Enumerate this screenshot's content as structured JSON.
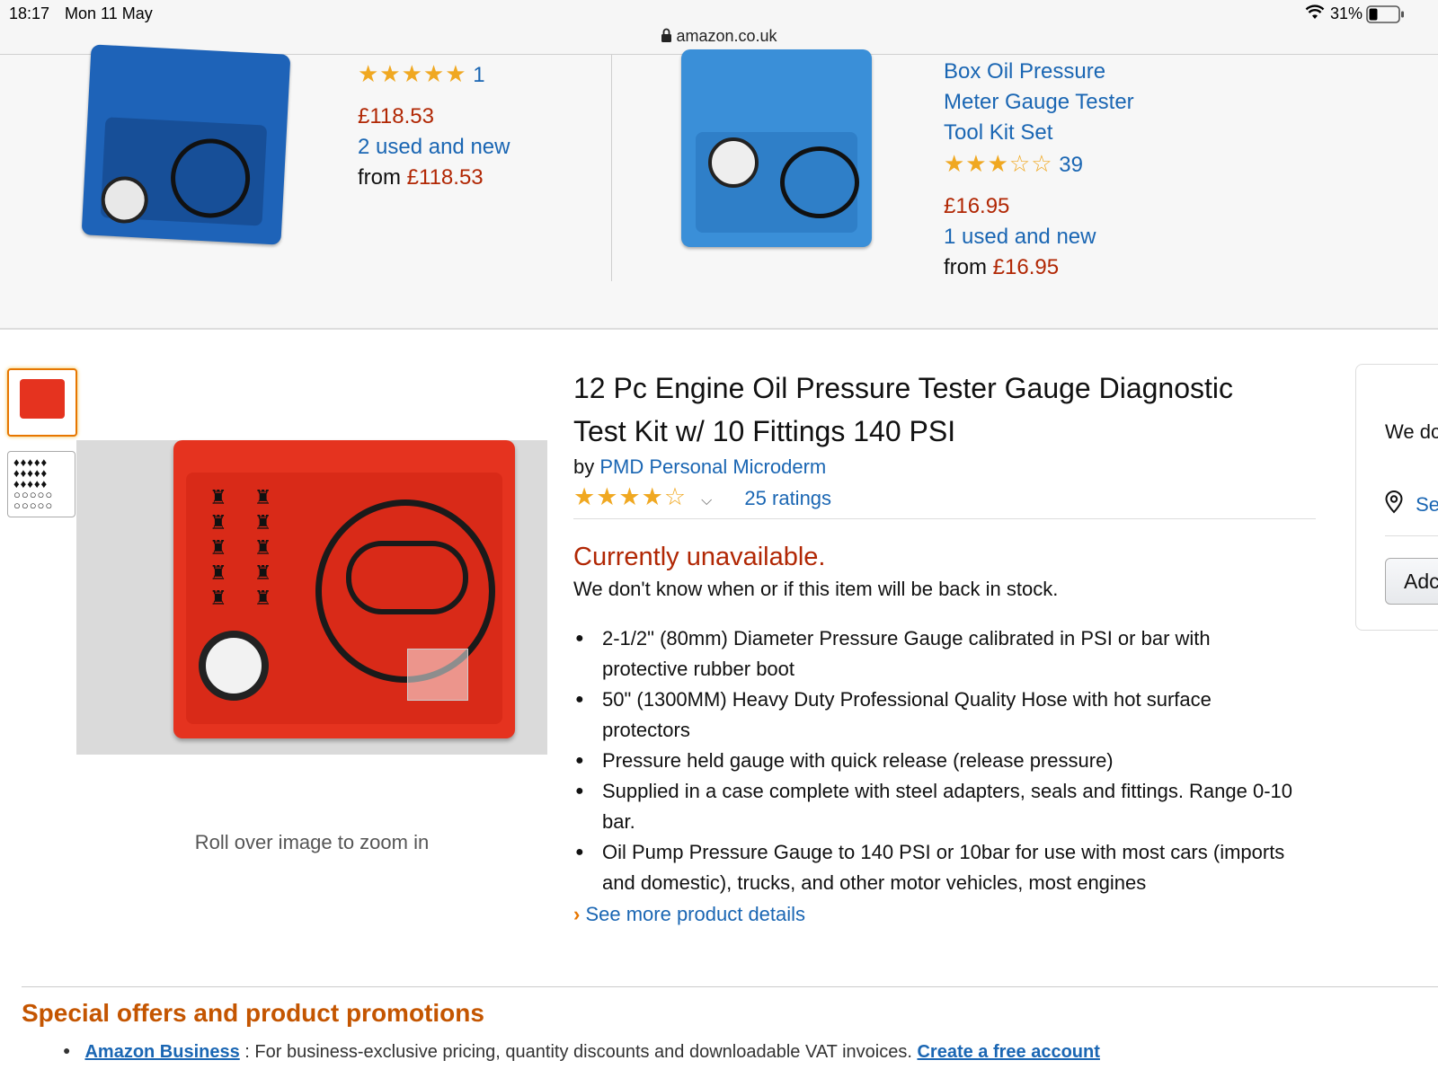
{
  "status_bar": {
    "time": "18:17",
    "date": "Mon 11 May",
    "battery": "31%",
    "url": "amazon.co.uk"
  },
  "carousel": {
    "left": {
      "rating_count": "1",
      "price": "£118.53",
      "used_new": "2 used and new",
      "from_label": "from",
      "from_price": "£118.53"
    },
    "right": {
      "title_lines": [
        "Box Oil Pressure",
        "Meter Gauge Tester",
        "Tool Kit Set"
      ],
      "rating_count": "39",
      "price": "£16.95",
      "used_new": "1 used and new",
      "from_label": "from",
      "from_price": "£16.95"
    }
  },
  "product": {
    "title_line1": "12 Pc Engine Oil Pressure Tester Gauge Diagnostic",
    "title_line2": "Test Kit w/ 10 Fittings 140 PSI",
    "by_label": "by",
    "brand": "PMD Personal Microderm",
    "ratings": "25 ratings",
    "rating_value": 4,
    "availability": "Currently unavailable.",
    "availability_note": "We don't know when or if this item will be back in stock.",
    "bullets": [
      "2-1/2\" (80mm) Diameter Pressure Gauge calibrated in PSI or bar with protective rubber boot",
      "50\" (1300MM) Heavy Duty Professional Quality Hose with hot surface protectors",
      "Pressure held gauge with quick release (release pressure)",
      "Supplied in a case complete with steel adapters, seals and fittings. Range 0-10 bar.",
      "Oil Pump Pressure Gauge to 140 PSI or 10bar for use with most cars (imports and domestic), trucks, and other motor vehicles, most engines"
    ],
    "see_more": "See more product details",
    "zoom_hint": "Roll over image to zoom in"
  },
  "buybox": {
    "text": "We dc",
    "location": "Se",
    "button": "Adc"
  },
  "offers": {
    "title": "Special offers and product promotions",
    "item_link": "Amazon Business",
    "item_text": " : For business-exclusive pricing, quantity discounts and downloadable VAT invoices. ",
    "item_cta": "Create a free account"
  },
  "colors": {
    "price": "#b12704",
    "link": "#1a66b3",
    "star": "#f0a821",
    "section": "#c45500"
  }
}
